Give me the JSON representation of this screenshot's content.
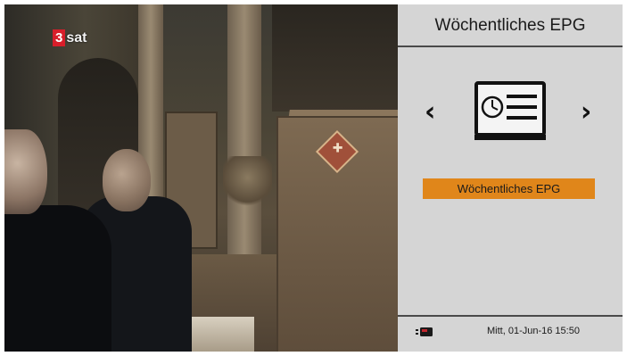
{
  "channel": {
    "logo_number": "3",
    "logo_text": "sat"
  },
  "menu": {
    "title": "Wöchentliches EPG",
    "prev_arrow": "‹",
    "next_arrow": "›",
    "selected_item_label": "Wöchentliches EPG",
    "center_icon": "epg-schedule-icon"
  },
  "footer": {
    "status_icon": "connection-status-icon",
    "datetime": "Mitt, 01-Jun-16  15:50"
  },
  "colors": {
    "panel_background": "#d5d5d5",
    "highlight": "#e0861a",
    "channel_logo_red": "#d81e2a"
  }
}
